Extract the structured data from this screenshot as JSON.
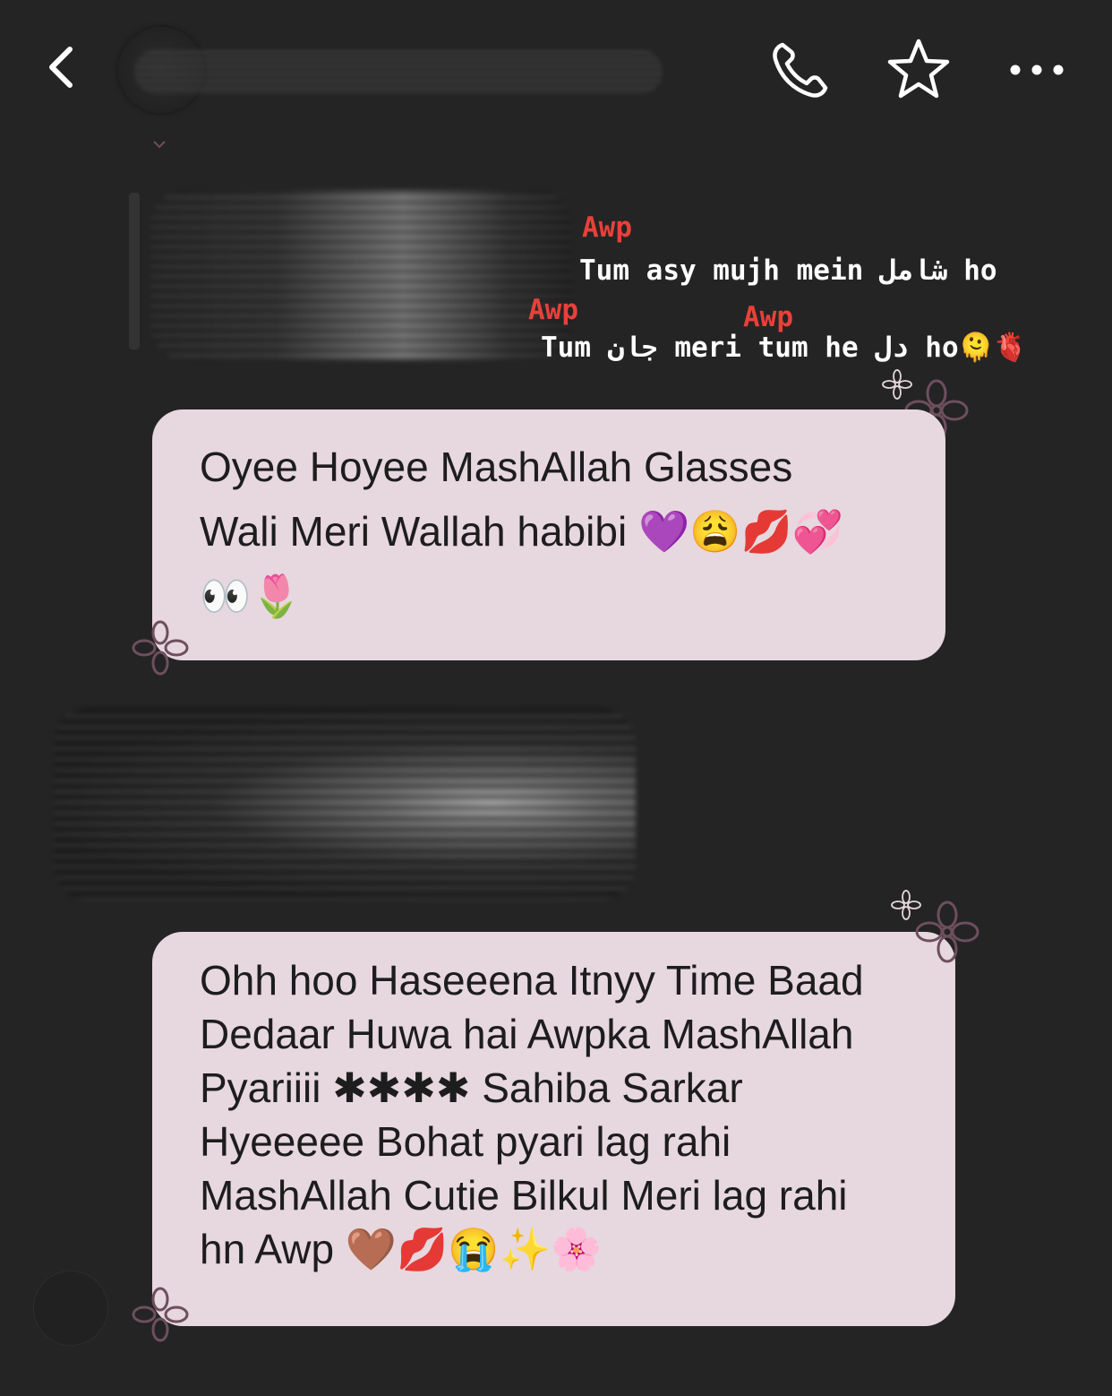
{
  "header": {
    "back_icon": "chevron-left-icon",
    "call_icon": "phone-icon",
    "star_icon": "star-icon",
    "more_icon": "more-horizontal-icon"
  },
  "overlay": {
    "tag_1": "Awp",
    "line_1": "Tum asy mujh mein شامل ho",
    "tag_2": "Awp",
    "tag_3": "Awp",
    "line_2": "Tum جان meri tum he دل ho",
    "line_2_emoji": "🫠🫀"
  },
  "messages": [
    {
      "text": "Oyee Hoyee MashAllah Glasses\nWali Meri Wallah habibi 💜😩💋💞\n👀🌷"
    },
    {
      "text": "Ohh hoo Haseeena Itnyy Time Baad\nDedaar Huwa hai Awpka MashAllah\nPyariiii ✱✱✱✱ Sahiba Sarkar\nHyeeeee Bohat pyari lag rahi\nMashAllah Cutie Bilkul Meri lag rahi\nhn Awp 🤎💋😭✨🌸"
    }
  ],
  "colors": {
    "background": "#242424",
    "bubble": "#e7d7de",
    "tag": "#e8413a",
    "flower_stroke": "#6e4f5d"
  }
}
